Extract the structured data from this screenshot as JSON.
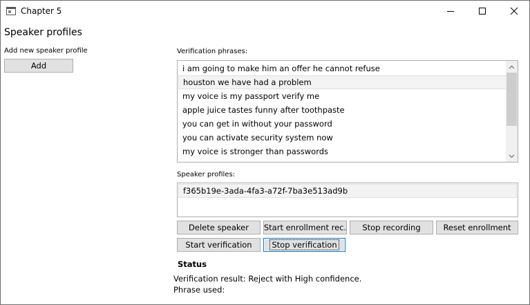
{
  "window": {
    "title": "Chapter 5"
  },
  "page": {
    "heading": "Speaker profiles"
  },
  "left_panel": {
    "add_label": "Add new speaker profile",
    "add_button": "Add"
  },
  "phrases": {
    "label": "Verification phrases:",
    "items": [
      "i am going to make him an offer he cannot refuse",
      "houston we have had a problem",
      "my voice is my passport verify me",
      "apple juice tastes funny after toothpaste",
      "you can get in without your password",
      "you can activate security system now",
      "my voice is stronger than passwords"
    ],
    "selected_index": 1
  },
  "profiles": {
    "label": "Speaker profiles:",
    "items": [
      "f365b19e-3ada-4fa3-a72f-7ba3e513ad9b"
    ]
  },
  "buttons": {
    "delete_speaker": "Delete speaker",
    "start_enrollment": "Start enrollment rec.",
    "stop_recording": "Stop recording",
    "reset_enrollment": "Reset enrollment",
    "start_verification": "Start verification",
    "stop_verification": "Stop verification"
  },
  "status": {
    "heading": "Status",
    "result": "Verification result: Reject with High confidence.",
    "phrase": "Phrase used:"
  },
  "icons": {
    "app": "app-window-icon",
    "minimize": "minimize-icon",
    "maximize": "maximize-icon",
    "close": "close-icon"
  },
  "colors": {
    "focus_border": "#0078d7",
    "button_face": "#e1e1e1",
    "border": "#adadad"
  }
}
